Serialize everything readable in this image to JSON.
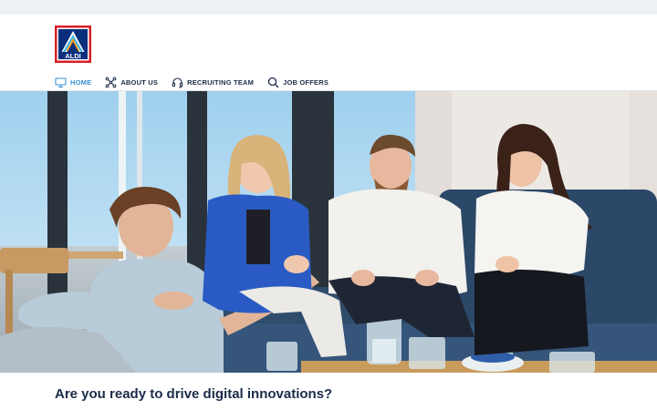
{
  "brand": {
    "name": "ALDI",
    "logo_colors": {
      "red": "#d61f26",
      "blue": "#0a2f7c",
      "light_blue": "#3bb4e5",
      "orange": "#f49a1a"
    }
  },
  "nav": {
    "items": [
      {
        "label": "HOME",
        "icon": "monitor-icon",
        "active": true
      },
      {
        "label": "ABOUT US",
        "icon": "network-icon",
        "active": false
      },
      {
        "label": "RECRUITING TEAM",
        "icon": "headset-icon",
        "active": false
      },
      {
        "label": "JOB OFFERS",
        "icon": "search-icon",
        "active": false
      }
    ],
    "colors": {
      "active": "#3a8fd0",
      "default": "#1c2b48"
    }
  },
  "hero": {
    "image": "team-photo"
  },
  "main": {
    "headline": "Are you ready to drive digital innovations?"
  }
}
